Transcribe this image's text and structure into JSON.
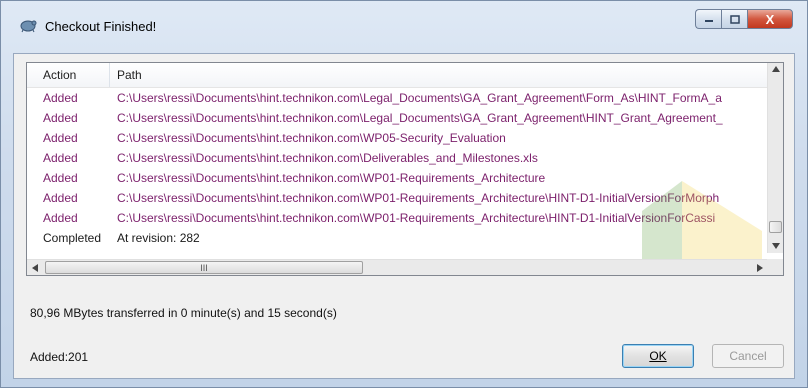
{
  "window": {
    "title": "Checkout Finished!",
    "close_glyph": "X"
  },
  "list": {
    "columns": [
      "Action",
      "Path"
    ],
    "rows": [
      {
        "action": "Added",
        "path": "C:\\Users\\ressi\\Documents\\hint.technikon.com\\Legal_Documents\\GA_Grant_Agreement\\Form_As\\HINT_FormA_a"
      },
      {
        "action": "Added",
        "path": "C:\\Users\\ressi\\Documents\\hint.technikon.com\\Legal_Documents\\GA_Grant_Agreement\\HINT_Grant_Agreement_"
      },
      {
        "action": "Added",
        "path": "C:\\Users\\ressi\\Documents\\hint.technikon.com\\WP05-Security_Evaluation"
      },
      {
        "action": "Added",
        "path": "C:\\Users\\ressi\\Documents\\hint.technikon.com\\Deliverables_and_Milestones.xls"
      },
      {
        "action": "Added",
        "path": "C:\\Users\\ressi\\Documents\\hint.technikon.com\\WP01-Requirements_Architecture"
      },
      {
        "action": "Added",
        "path": "C:\\Users\\ressi\\Documents\\hint.technikon.com\\WP01-Requirements_Architecture\\HINT-D1-InitialVersionForMorph"
      },
      {
        "action": "Added",
        "path": "C:\\Users\\ressi\\Documents\\hint.technikon.com\\WP01-Requirements_Architecture\\HINT-D1-InitialVersionForCassi"
      },
      {
        "action": "Completed",
        "path": "At revision: 282"
      }
    ],
    "hscroll_thumb_grip": "III"
  },
  "status": "80,96 MBytes transferred in 0 minute(s) and 15 second(s)",
  "added_count": "Added:201",
  "buttons": {
    "ok": "OK",
    "cancel": "Cancel"
  },
  "colors": {
    "added_text": "#7b1f6b",
    "window_frame": "#c9d6e6"
  }
}
